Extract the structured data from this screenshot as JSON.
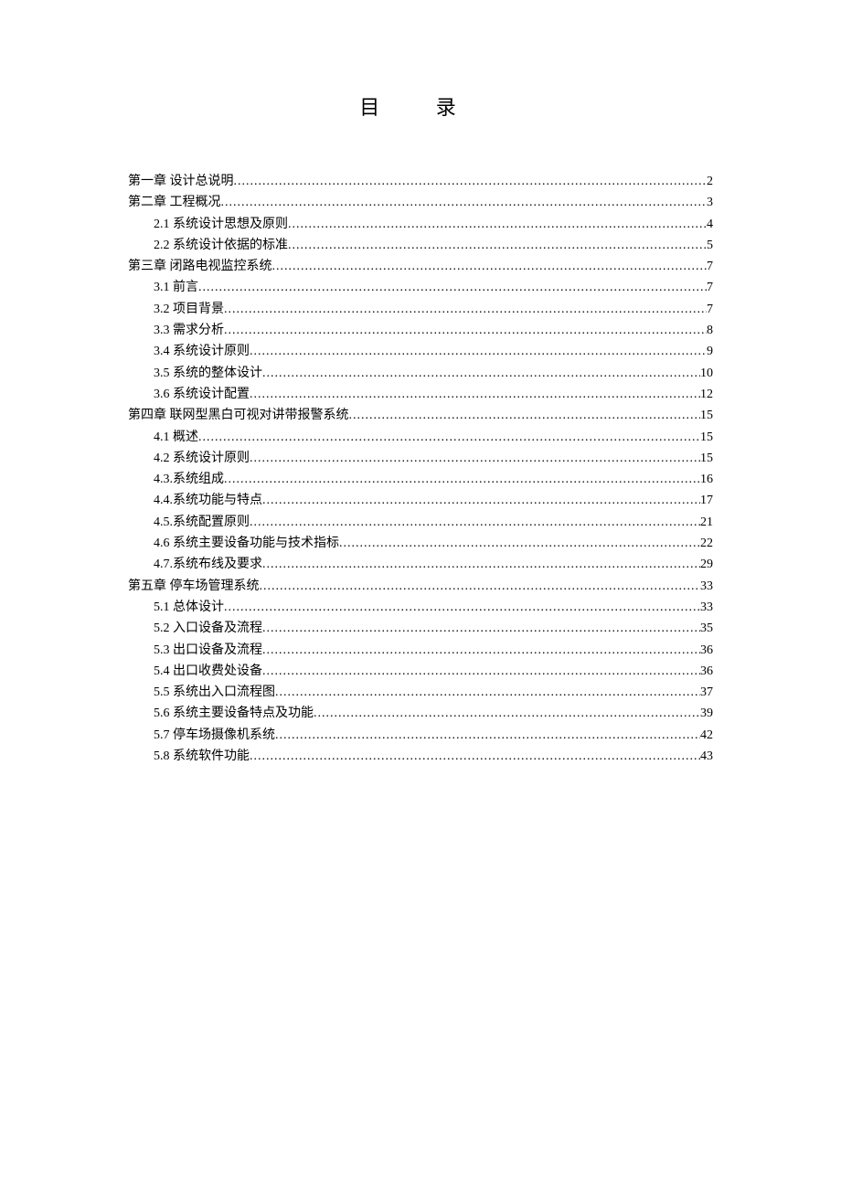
{
  "title": "目  录",
  "toc": [
    {
      "level": 0,
      "label": "第一章 设计总说明",
      "page": "2"
    },
    {
      "level": 0,
      "label": "第二章 工程概况",
      "page": "3"
    },
    {
      "level": 1,
      "label": "2.1 系统设计思想及原则",
      "page": "4"
    },
    {
      "level": 1,
      "label": "2.2 系统设计依据的标准",
      "page": "5"
    },
    {
      "level": 0,
      "label": "第三章 闭路电视监控系统",
      "page": "7"
    },
    {
      "level": 1,
      "label": "3.1 前言",
      "page": "7"
    },
    {
      "level": 1,
      "label": "3.2 项目背景",
      "page": "7"
    },
    {
      "level": 1,
      "label": "3.3 需求分析",
      "page": "8"
    },
    {
      "level": 1,
      "label": "3.4 系统设计原则",
      "page": "9"
    },
    {
      "level": 1,
      "label": "3.5 系统的整体设计",
      "page": "10"
    },
    {
      "level": 1,
      "label": "3.6 系统设计配置",
      "page": "12"
    },
    {
      "level": 0,
      "label": "第四章 联网型黑白可视对讲带报警系统",
      "page": "15"
    },
    {
      "level": 1,
      "label": "4.1 概述",
      "page": "15"
    },
    {
      "level": 1,
      "label": "4.2 系统设计原则",
      "page": "15"
    },
    {
      "level": 1,
      "label": "4.3.系统组成",
      "page": "16"
    },
    {
      "level": 1,
      "label": "4.4.系统功能与特点",
      "page": "17"
    },
    {
      "level": 1,
      "label": "4.5.系统配置原则",
      "page": "21"
    },
    {
      "level": 1,
      "label": "4.6 系统主要设备功能与技术指标",
      "page": "22"
    },
    {
      "level": 1,
      "label": "4.7.系统布线及要求",
      "page": "29"
    },
    {
      "level": 0,
      "label": "第五章 停车场管理系统",
      "page": "33"
    },
    {
      "level": 1,
      "label": "5.1 总体设计",
      "page": "33"
    },
    {
      "level": 1,
      "label": "5.2 入口设备及流程",
      "page": "35"
    },
    {
      "level": 1,
      "label": "5.3 出口设备及流程",
      "page": "36"
    },
    {
      "level": 1,
      "label": "5.4 出口收费处设备",
      "page": "36"
    },
    {
      "level": 1,
      "label": "5.5 系统出入口流程图",
      "page": "37"
    },
    {
      "level": 1,
      "label": "5.6 系统主要设备特点及功能",
      "page": "39"
    },
    {
      "level": 1,
      "label": "5.7 停车场摄像机系统",
      "page": "42"
    },
    {
      "level": 1,
      "label": "5.8 系统软件功能",
      "page": "43"
    }
  ]
}
